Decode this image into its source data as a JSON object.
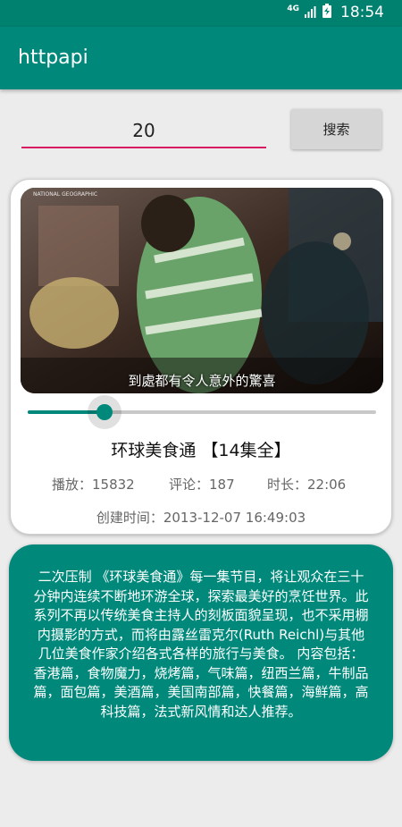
{
  "status_bar": {
    "network": "4G",
    "time": "18:54"
  },
  "app_bar": {
    "title": "httpapi"
  },
  "search": {
    "value": "20",
    "button_label": "搜索"
  },
  "video": {
    "subtitle_overlay": "到處都有令人意外的驚喜",
    "logo_text": "NATIONAL GEOGRAPHIC",
    "progress": 0.22,
    "title": "环球美食通 【14集全】",
    "play_count": "播放：15832",
    "comment_count": "评论：187",
    "duration": "时长：22:06",
    "created": "创建时间：2013-12-07 16:49:03"
  },
  "description": "二次压制 《环球美食通》每一集节目，将让观众在三十分钟内连续不断地环游全球，探索最美好的烹饪世界。此系列不再以传统美食主持人的刻板面貌呈现，也不采用棚内摄影的方式，而将由露丝雷克尔(Ruth Reichl)与其他几位美食作家介绍各式各样的旅行与美食。 内容包括：香港篇，食物魔力，烧烤篇，气味篇，纽西兰篇，牛制品篇，面包篇，美酒篇，美国南部篇，快餐篇，海鲜篇，高科技篇，法式新风情和达人推荐。",
  "colors": {
    "primary": "#00897b",
    "status_bar": "#00806e",
    "accent": "#d81b60"
  }
}
